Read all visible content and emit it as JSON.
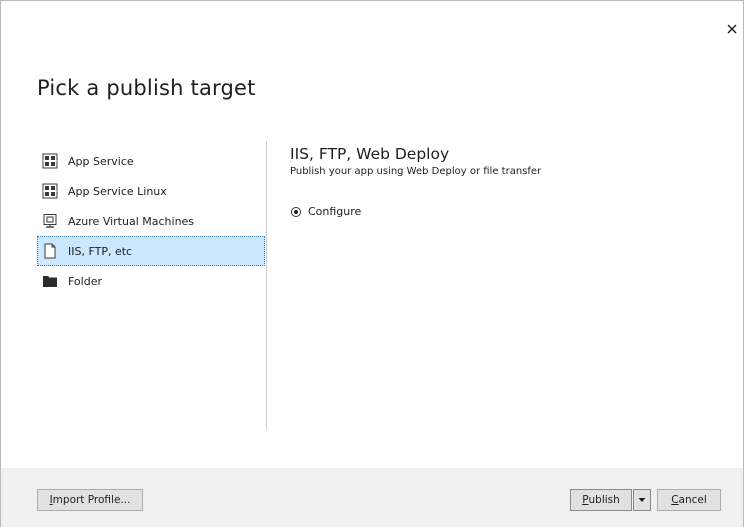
{
  "dialog": {
    "title": "Pick a publish target",
    "close_icon": "close-icon"
  },
  "targets": [
    {
      "label": "App Service",
      "icon": "app-service-icon",
      "selected": false
    },
    {
      "label": "App Service Linux",
      "icon": "app-service-linux-icon",
      "selected": false
    },
    {
      "label": "Azure Virtual Machines",
      "icon": "virtual-machine-icon",
      "selected": false
    },
    {
      "label": "IIS, FTP, etc",
      "icon": "document-icon",
      "selected": true
    },
    {
      "label": "Folder",
      "icon": "folder-icon",
      "selected": false
    }
  ],
  "detail": {
    "title": "IIS, FTP, Web Deploy",
    "subtitle": "Publish your app using Web Deploy or file transfer",
    "option": {
      "label": "Configure",
      "checked": true
    }
  },
  "footer": {
    "import_label_first": "I",
    "import_label_rest": "mport Profile...",
    "publish_label_first": "P",
    "publish_label_rest": "ublish",
    "dropdown_icon": "dropdown-arrow-icon",
    "cancel_label_first": "C",
    "cancel_label_rest": "ancel"
  },
  "colors": {
    "selection_bg": "#cce8ff",
    "selection_border": "#3c7fb1",
    "footer_bg": "#f0f0f0",
    "button_bg": "#e1e1e1"
  }
}
